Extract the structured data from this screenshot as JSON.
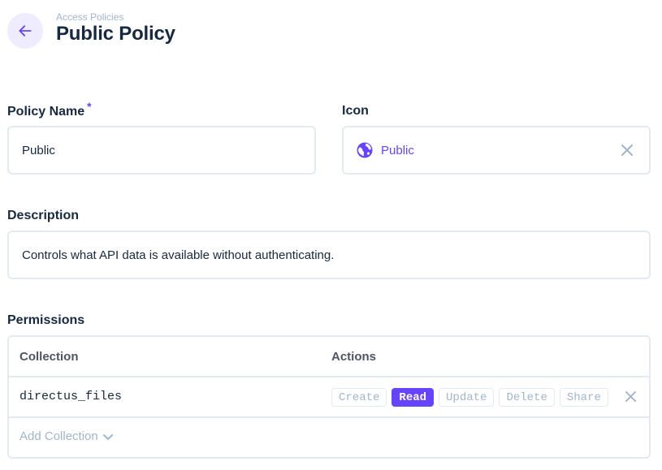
{
  "header": {
    "breadcrumb": "Access Policies",
    "title": "Public Policy",
    "back_icon": "arrow-left-icon"
  },
  "form": {
    "policy_name": {
      "label": "Policy Name",
      "required_mark": "*",
      "value": "Public"
    },
    "icon": {
      "label": "Icon",
      "value": "Public",
      "icon": "globe-icon",
      "clear_icon": "close-icon"
    },
    "description": {
      "label": "Description",
      "value": "Controls what API data is available without authenticating."
    }
  },
  "permissions": {
    "label": "Permissions",
    "columns": {
      "collection": "Collection",
      "actions": "Actions"
    },
    "rows": [
      {
        "collection": "directus_files",
        "actions": [
          {
            "label": "Create",
            "active": false
          },
          {
            "label": "Read",
            "active": true
          },
          {
            "label": "Update",
            "active": false
          },
          {
            "label": "Delete",
            "active": false
          },
          {
            "label": "Share",
            "active": false
          }
        ]
      }
    ],
    "add_collection": "Add Collection"
  },
  "colors": {
    "accent": "#6644ff",
    "text": "#172940",
    "muted": "#a2b5cd",
    "border": "#e4eaf1"
  }
}
